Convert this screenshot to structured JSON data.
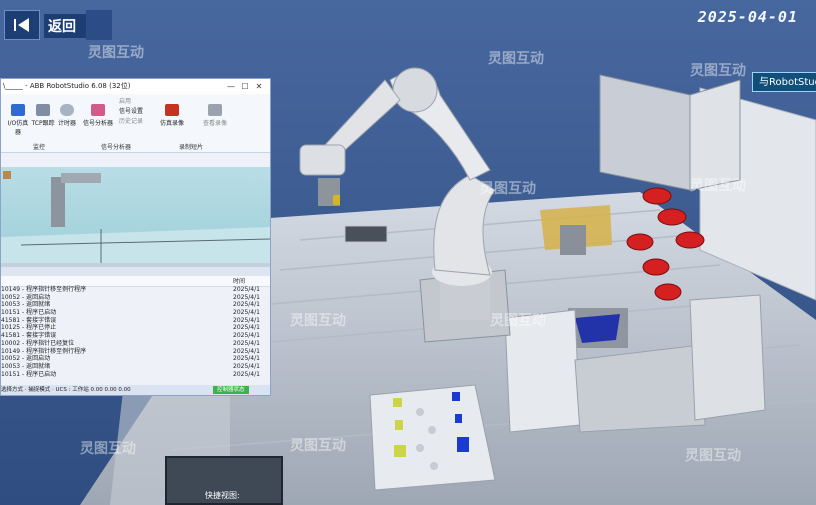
{
  "header": {
    "back_label": "返回",
    "date": "2025-04-01",
    "robotstudio_tab": "与RobotStudio"
  },
  "window": {
    "title": "\\_____ - ABB RobotStudio 6.08 (32位)",
    "ribbon": {
      "items": [
        "I/O仿真器",
        "TCP跟踪",
        "计时器",
        "信号分析器",
        "启用",
        "信号设置",
        "历史记录",
        "仿真录像",
        "查看录像"
      ],
      "groups": [
        "监控",
        "信号分析器",
        "录制短片"
      ]
    },
    "output_header": "时间",
    "output_rows": [
      {
        "msg": "10149 - 程序指针移至例行程序",
        "date": "2025/4/1"
      },
      {
        "msg": "10052 - 返回启动",
        "date": "2025/4/1"
      },
      {
        "msg": "10053 - 返回就绪",
        "date": "2025/4/1"
      },
      {
        "msg": "10151 - 程序已启动",
        "date": "2025/4/1"
      },
      {
        "msg": "41581 - 套接字错误",
        "date": "2025/4/1"
      },
      {
        "msg": "10125 - 程序已停止",
        "date": "2025/4/1"
      },
      {
        "msg": "41581 - 套接字错误",
        "date": "2025/4/1"
      },
      {
        "msg": "10002 - 程序指针已经复位",
        "date": "2025/4/1"
      },
      {
        "msg": "10149 - 程序指针移至例行程序",
        "date": "2025/4/1"
      },
      {
        "msg": "10052 - 返回启动",
        "date": "2025/4/1"
      },
      {
        "msg": "10053 - 返回就绪",
        "date": "2025/4/1"
      },
      {
        "msg": "10151 - 程序已启动",
        "date": "2025/4/1"
      }
    ],
    "status": {
      "left": "选择方式 · 捕捉模式 · UCS : 工作站  0.00  0.00  0.00",
      "controller": "控制器状态"
    }
  },
  "quick_view": "快捷视图:",
  "watermark": "灵图互动"
}
